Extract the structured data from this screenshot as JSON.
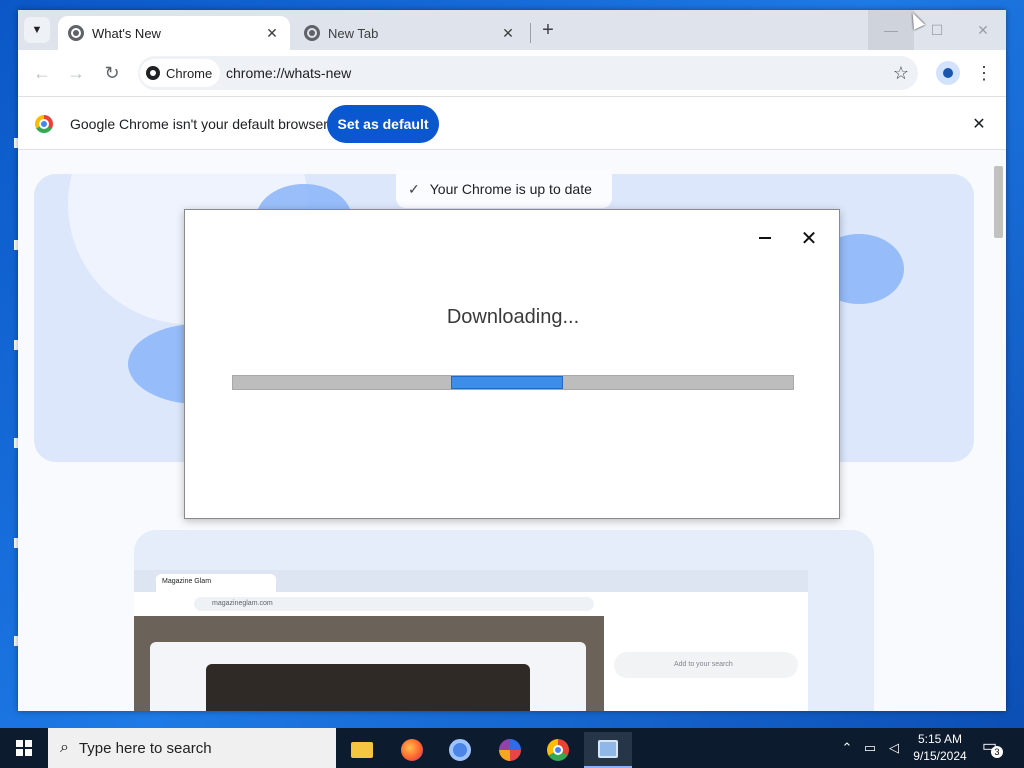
{
  "browser": {
    "tabs": [
      {
        "title": "What's New",
        "active": true
      },
      {
        "title": "New Tab",
        "active": false
      }
    ],
    "tab_close_glyph": "✕",
    "new_tab_glyph": "+",
    "omnibox": {
      "chip_label": "Chrome",
      "url": "chrome://whats-new"
    },
    "nav": {
      "back": "←",
      "forward": "→",
      "reload": "↻",
      "menu": "⋮",
      "star": "☆"
    },
    "window_controls": {
      "minimize": "—",
      "maximize": "☐",
      "close": "✕"
    }
  },
  "infobar": {
    "message": "Google Chrome isn't your default browser",
    "button": "Set as default",
    "close": "✕"
  },
  "page": {
    "status": "Your Chrome is up to date",
    "status_check": "✓",
    "mini_browser": {
      "tab_title": "Magazine Glam",
      "url": "magazineglam.com",
      "search_placeholder": "Add to your search"
    }
  },
  "dialog": {
    "title": "Downloading...",
    "close": "✕",
    "progress_start": 0.39,
    "progress_end": 0.59
  },
  "taskbar": {
    "search_placeholder": "Type here to search",
    "time": "5:15 AM",
    "date": "9/15/2024",
    "notification_count": "3",
    "apps": [
      "file-explorer",
      "firefox",
      "chromium",
      "app-s",
      "chrome",
      "control-panel"
    ]
  },
  "colors": {
    "accent": "#0b57d0",
    "progress": "#3c8ee8",
    "taskbar": "#0d1b2e"
  }
}
